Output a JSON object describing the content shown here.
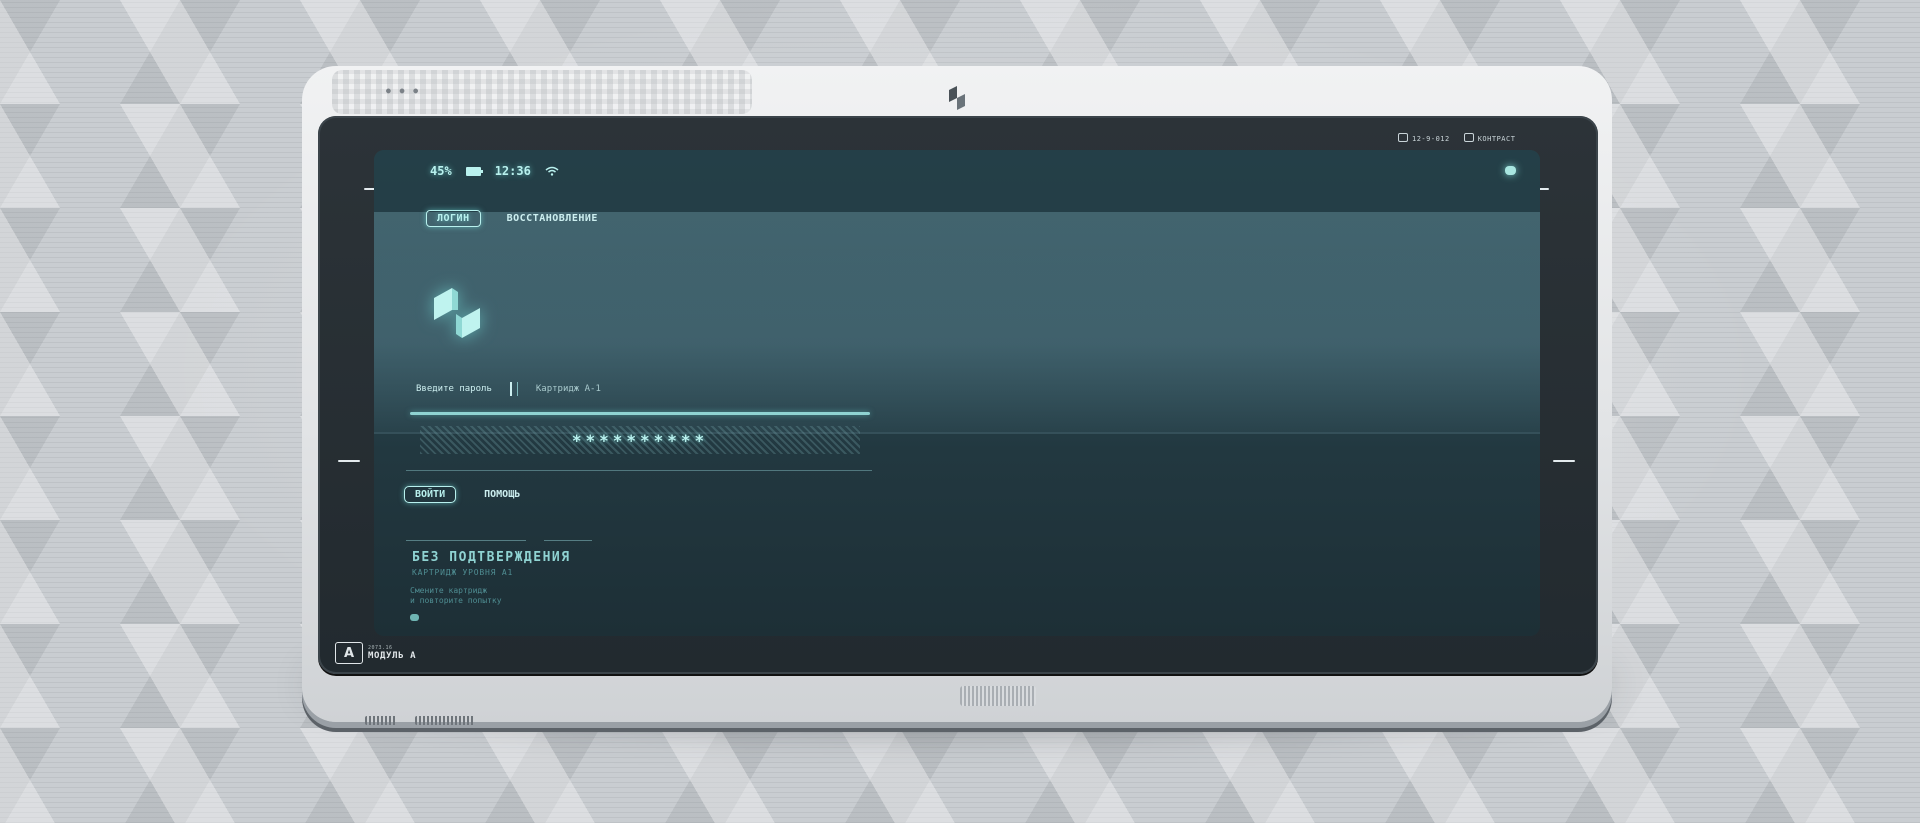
{
  "status": {
    "battery": "45%",
    "time": "12:36"
  },
  "tabs": [
    {
      "label": "ЛОГИН",
      "active": true
    },
    {
      "label": "ВОССТАНОВЛЕНИЕ",
      "active": false
    }
  ],
  "login": {
    "field_label": "Введите пароль",
    "cartridge": "Картридж А-1",
    "password_mask": "**********"
  },
  "actions": {
    "submit_label": "ВОЙТИ",
    "help_label": "ПОМОЩЬ"
  },
  "notice": {
    "title": "БЕЗ ПОДТВЕРЖДЕНИЯ",
    "subtitle": "КАРТРИДЖ УРОВНЯ А1",
    "line1": "Смените картридж",
    "line2": "и повторите попытку"
  },
  "bezel": {
    "serial": "12-9-012",
    "contrast_label": "КОНТРАСТ",
    "module_letter": "A",
    "module_small": "2073.16",
    "module_name": "МОДУЛЬ А"
  },
  "colors": {
    "accent": "#b9f1ee",
    "screen": "#2a4550",
    "bezel": "#262d32",
    "shell": "#e2e4e6"
  },
  "icons": {
    "battery": "battery-icon",
    "wifi": "wifi-icon",
    "brand": "brand-logo-icon"
  }
}
